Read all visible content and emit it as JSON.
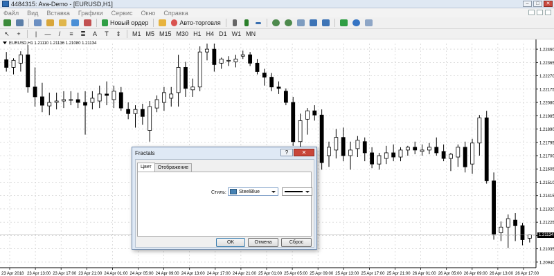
{
  "window": {
    "title": "4484315: Ava-Demo - [EURUSD,H1]"
  },
  "menu": [
    "Файл",
    "Вид",
    "Вставка",
    "Графики",
    "Сервис",
    "Окно",
    "Справка"
  ],
  "toolbar": {
    "new_order_label": "Новый ордер",
    "autotrading_label": "Авто-торговля",
    "timeframes": [
      "M1",
      "M5",
      "M15",
      "M30",
      "H1",
      "H4",
      "D1",
      "W1",
      "MN"
    ]
  },
  "chart": {
    "header": "EURUSD,H1  1.21110 1.21136 1.21080 1.21134",
    "current_price": "1.21134"
  },
  "chart_data": {
    "type": "candlestick",
    "symbol": "EURUSD",
    "timeframe": "H1",
    "ohlc_last": {
      "open": 1.2111,
      "high": 1.21136,
      "low": 1.2108,
      "close": 1.21134
    },
    "y_ticks": [
      "1.22460",
      "1.22365",
      "1.22270",
      "1.22175",
      "1.22080",
      "1.21985",
      "1.21890",
      "1.21795",
      "1.21700",
      "1.21605",
      "1.21510",
      "1.21415",
      "1.21320",
      "1.21225",
      "1.21130",
      "1.21035",
      "1.20940"
    ],
    "x_ticks": [
      "23 Apr 2018",
      "23 Apr 13:00",
      "23 Apr 17:00",
      "23 Apr 21:00",
      "24 Apr 01:00",
      "24 Apr 05:00",
      "24 Apr 09:00",
      "24 Apr 13:00",
      "24 Apr 17:00",
      "24 Apr 21:00",
      "25 Apr 01:00",
      "25 Apr 05:00",
      "25 Apr 09:00",
      "25 Apr 13:00",
      "25 Apr 17:00",
      "25 Apr 21:00",
      "26 Apr 01:00",
      "26 Apr 05:00",
      "26 Apr 09:00",
      "26 Apr 13:00",
      "26 Apr 17:00"
    ],
    "grid": true,
    "candles": [
      [
        1.22385,
        1.2244,
        1.223,
        1.2233
      ],
      [
        1.2233,
        1.22395,
        1.2228,
        1.2238
      ],
      [
        1.2236,
        1.22445,
        1.223,
        1.2242
      ],
      [
        1.2242,
        1.2249,
        1.2215,
        1.2219
      ],
      [
        1.2219,
        1.2233,
        1.2205,
        1.2212
      ],
      [
        1.2212,
        1.2222,
        1.2201,
        1.2206
      ],
      [
        1.22055,
        1.2215,
        1.2199,
        1.2208
      ],
      [
        1.2208,
        1.2215,
        1.2203,
        1.2209
      ],
      [
        1.2209,
        1.2216,
        1.2204,
        1.221
      ],
      [
        1.221,
        1.2216,
        1.2206,
        1.221
      ],
      [
        1.221,
        1.2215,
        1.2204,
        1.2208
      ],
      [
        1.2208,
        1.2216,
        1.2185,
        1.2206
      ],
      [
        1.2208,
        1.2216,
        1.2203,
        1.2211
      ],
      [
        1.2209,
        1.222,
        1.2204,
        1.2214
      ],
      [
        1.2214,
        1.2223,
        1.2206,
        1.2213
      ],
      [
        1.221,
        1.222,
        1.2204,
        1.2216
      ],
      [
        1.2215,
        1.2219,
        1.2202,
        1.2204
      ],
      [
        1.2203,
        1.2208,
        1.2196,
        1.22
      ],
      [
        1.22,
        1.2206,
        1.219,
        1.2203
      ],
      [
        1.2203,
        1.2207,
        1.2192,
        1.2198
      ],
      [
        1.2188,
        1.2209,
        1.218,
        1.2205
      ],
      [
        1.2204,
        1.2213,
        1.2201,
        1.221
      ],
      [
        1.2208,
        1.2219,
        1.2202,
        1.2215
      ],
      [
        1.2211,
        1.2219,
        1.2205,
        1.2214
      ],
      [
        1.2215,
        1.2242,
        1.2205,
        1.2233
      ],
      [
        1.2233,
        1.2237,
        1.2212,
        1.2218
      ],
      [
        1.2217,
        1.2225,
        1.2212,
        1.2219
      ],
      [
        1.2219,
        1.2248,
        1.2216,
        1.2244
      ],
      [
        1.2244,
        1.225,
        1.2238,
        1.2246
      ],
      [
        1.2246,
        1.225,
        1.223,
        1.2235
      ],
      [
        1.2236,
        1.224,
        1.2232,
        1.2239
      ],
      [
        1.2238,
        1.2241,
        1.2234,
        1.2238
      ],
      [
        1.2237,
        1.2242,
        1.2233,
        1.2239
      ],
      [
        1.2241,
        1.2245,
        1.2239,
        1.2242
      ],
      [
        1.2242,
        1.2244,
        1.2234,
        1.2236
      ],
      [
        1.2236,
        1.2239,
        1.2228,
        1.223
      ],
      [
        1.2229,
        1.2232,
        1.222,
        1.2226
      ],
      [
        1.2226,
        1.2229,
        1.2216,
        1.2219
      ],
      [
        1.2219,
        1.2223,
        1.2214,
        1.2218
      ],
      [
        1.2216,
        1.2218,
        1.2206,
        1.2208
      ],
      [
        1.2208,
        1.2212,
        1.2177,
        1.218
      ],
      [
        1.218,
        1.22,
        1.2176,
        1.2195
      ],
      [
        1.2196,
        1.2204,
        1.2185,
        1.2202
      ],
      [
        1.2202,
        1.2206,
        1.2195,
        1.2199
      ],
      [
        1.2199,
        1.2203,
        1.216,
        1.2165
      ],
      [
        1.217,
        1.218,
        1.2162,
        1.2176
      ],
      [
        1.2174,
        1.2189,
        1.2168,
        1.2183
      ],
      [
        1.2183,
        1.219,
        1.2166,
        1.217
      ],
      [
        1.217,
        1.218,
        1.216,
        1.2174
      ],
      [
        1.2175,
        1.2184,
        1.2169,
        1.2181
      ],
      [
        1.218,
        1.2183,
        1.2166,
        1.2172
      ],
      [
        1.2172,
        1.2176,
        1.2161,
        1.2164
      ],
      [
        1.2164,
        1.2172,
        1.216,
        1.217
      ],
      [
        1.2168,
        1.2177,
        1.2164,
        1.2172
      ],
      [
        1.2172,
        1.2178,
        1.2166,
        1.2169
      ],
      [
        1.2169,
        1.2176,
        1.2166,
        1.2174
      ],
      [
        1.2174,
        1.2177,
        1.217,
        1.2176
      ],
      [
        1.2176,
        1.218,
        1.2171,
        1.2174
      ],
      [
        1.2173,
        1.2178,
        1.217,
        1.2174
      ],
      [
        1.2174,
        1.2179,
        1.2171,
        1.2176
      ],
      [
        1.2176,
        1.2183,
        1.217,
        1.2172
      ],
      [
        1.2173,
        1.2178,
        1.2166,
        1.2168
      ],
      [
        1.2168,
        1.2172,
        1.2159,
        1.2171
      ],
      [
        1.2169,
        1.2178,
        1.2162,
        1.2176
      ],
      [
        1.2176,
        1.218,
        1.2158,
        1.2162
      ],
      [
        1.2164,
        1.2182,
        1.2157,
        1.2179
      ],
      [
        1.2179,
        1.2199,
        1.217,
        1.2197
      ],
      [
        1.2197,
        1.2202,
        1.215,
        1.2152
      ],
      [
        1.2152,
        1.2158,
        1.211,
        1.2114
      ],
      [
        1.2115,
        1.2123,
        1.2109,
        1.2119
      ],
      [
        1.2119,
        1.2128,
        1.2104,
        1.2125
      ],
      [
        1.2124,
        1.2129,
        1.2109,
        1.212
      ],
      [
        1.212,
        1.2122,
        1.2106,
        1.211
      ],
      [
        1.2111,
        1.21136,
        1.2108,
        1.21134
      ]
    ]
  },
  "dialog": {
    "title": "Fractals",
    "help_label": "?",
    "close_label": "✕",
    "tabs": [
      "Цвет",
      "Отображение"
    ],
    "style_label": "Стиль:",
    "color_value": "SteelBlue",
    "color_hex": "#4682B4",
    "ok_label": "OK",
    "cancel_label": "Отмена",
    "reset_label": "Сброс"
  }
}
